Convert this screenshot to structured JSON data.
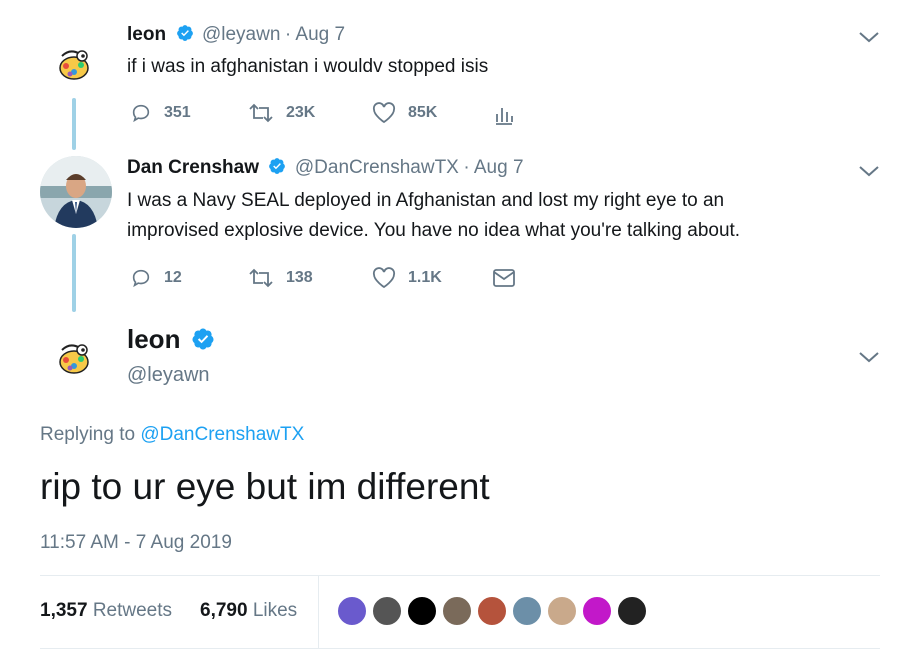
{
  "tweet1": {
    "display_name": "leon",
    "handle": "@leyawn",
    "date": "· Aug 7",
    "text": "if i was in afghanistan i wouldv stopped isis",
    "replies": "351",
    "retweets": "23K",
    "likes": "85K",
    "avatar_icon": "bird-avatar-icon"
  },
  "tweet2": {
    "display_name": "Dan Crenshaw",
    "handle": "@DanCrenshawTX",
    "date": "· Aug 7",
    "text_line1": "I was a Navy SEAL deployed in Afghanistan and lost my right eye to an",
    "text_line2": "improvised explosive device. You have no idea what you're talking about.",
    "replies": "12",
    "retweets": "138",
    "likes": "1.1K",
    "avatar_icon": "man-in-suit-avatar"
  },
  "main": {
    "display_name": "leon",
    "handle": "@leyawn",
    "replying_prefix": "Replying to ",
    "replying_handle": "@DanCrenshawTX",
    "text": "rip to ur eye but im different",
    "timestamp": "11:57 AM - 7 Aug 2019",
    "retweet_count": "1,357",
    "retweet_label": "Retweets",
    "like_count": "6,790",
    "like_label": "Likes"
  },
  "colors": {
    "accent": "#1da1f2",
    "muted": "#657786",
    "text": "#14171a",
    "thread_line": "#9fd1e6",
    "divider": "#e6ecf0"
  },
  "liker_avatars": [
    {
      "name": "liker-avatar-anime",
      "color": "#6a5acd"
    },
    {
      "name": "liker-avatar-dark-figure",
      "color": "#555555"
    },
    {
      "name": "liker-avatar-black",
      "color": "#000000"
    },
    {
      "name": "liker-avatar-man",
      "color": "#7a6a5a"
    },
    {
      "name": "liker-avatar-portrait-red",
      "color": "#b5533c"
    },
    {
      "name": "liker-avatar-blue-art",
      "color": "#6c8fa8"
    },
    {
      "name": "liker-avatar-bird",
      "color": "#c9a98b"
    },
    {
      "name": "liker-avatar-magenta",
      "color": "#c218c9"
    },
    {
      "name": "liker-avatar-dark-art",
      "color": "#222222"
    }
  ]
}
